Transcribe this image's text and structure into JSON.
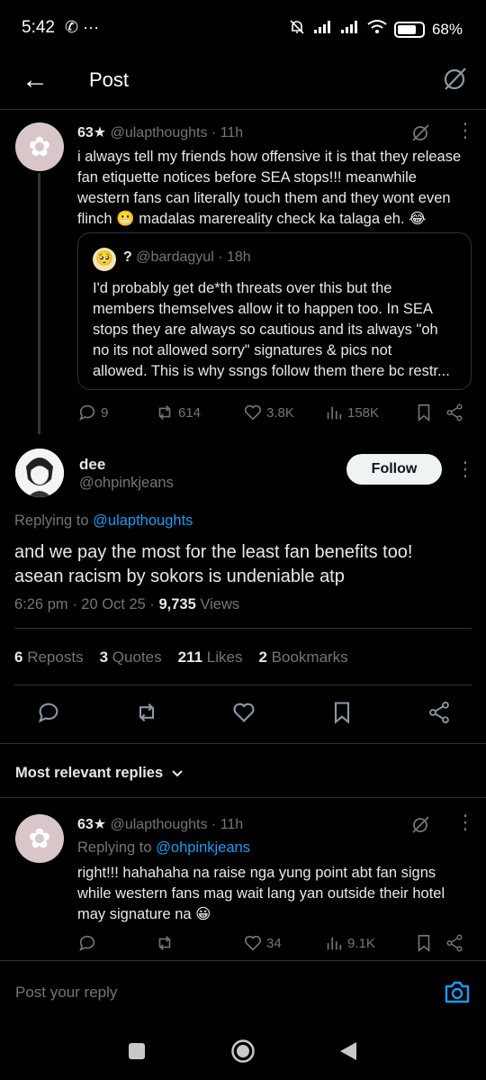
{
  "status": {
    "time": "5:42",
    "left_icons": "✆ ···",
    "battery": "68%"
  },
  "header": {
    "title": "Post"
  },
  "parent_post": {
    "badge": "63★",
    "handle": "@ulapthoughts",
    "time": "· 11h",
    "text_lines": [
      "i always tell my friends how offensive it is that they release",
      "fan etiquette notices before SEA stops!!! meanwhile",
      "western fans can literally touch them and they wont even",
      "flinch 😬 madalas marereality check ka talaga eh. 😂"
    ],
    "quote": {
      "badge": "?",
      "handle": "@bardagyul",
      "time": "· 18h",
      "avatar_emoji": "🥺",
      "text_lines": [
        "I'd probably get de*th threats over this but the",
        "members themselves allow it to happen too. In SEA",
        "stops they are always so cautious and its always \"oh",
        "no its not allowed sorry\" signatures & pics not",
        "allowed. This is why ssngs follow them there bc restr..."
      ]
    },
    "actions": {
      "replies": "9",
      "reposts": "614",
      "likes": "3.8K",
      "views": "158K"
    }
  },
  "main_post": {
    "name": "dee",
    "handle": "@ohpinkjeans",
    "follow_label": "Follow",
    "replying_prefix": "Replying to",
    "replying_to": "@ulapthoughts",
    "text_lines": [
      "and we pay the most for the least fan benefits too!",
      "asean racism by sokors is undeniable atp"
    ],
    "timestamp": "6:26 pm · 20 Oct 25 ·",
    "views_count": "9,735",
    "views_label": "Views",
    "stats": [
      {
        "count": "6",
        "label": "Reposts"
      },
      {
        "count": "3",
        "label": "Quotes"
      },
      {
        "count": "211",
        "label": "Likes"
      },
      {
        "count": "2",
        "label": "Bookmarks"
      }
    ]
  },
  "replies_filter": {
    "label": "Most relevant replies"
  },
  "reply_post": {
    "badge": "63★",
    "handle": "@ulapthoughts",
    "time": "· 11h",
    "replying_prefix": "Replying to",
    "replying_to": "@ohpinkjeans",
    "text_lines": [
      "right!!! hahahaha na raise nga yung point abt fan signs",
      "while western fans mag wait lang yan outside their hotel",
      "may signature na 😀"
    ],
    "actions": {
      "replies": "",
      "reposts": "",
      "likes": "34",
      "views": "9.1K"
    }
  },
  "composer": {
    "placeholder": "Post your reply"
  },
  "colors": {
    "accent": "#1d9bf0",
    "muted": "#71767b",
    "text": "#e7e9ea",
    "border": "#2f3336"
  }
}
